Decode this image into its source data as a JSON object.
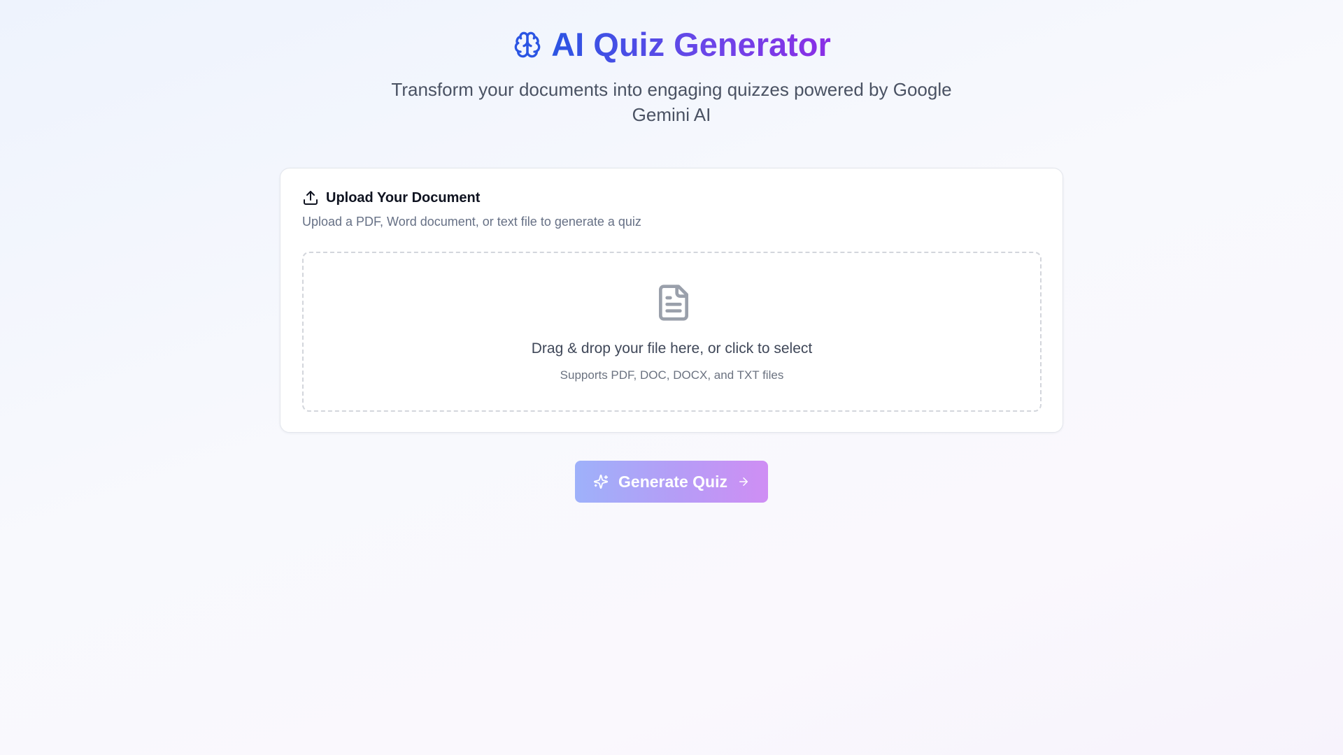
{
  "header": {
    "title": "AI Quiz Generator",
    "title_icon": "brain-icon",
    "subtitle": "Transform your documents into engaging quizzes powered by Google Gemini AI"
  },
  "upload_card": {
    "icon": "upload-icon",
    "title": "Upload Your Document",
    "description": "Upload a PDF, Word document, or text file to generate a quiz",
    "dropzone": {
      "icon": "file-text-icon",
      "main_text": "Drag & drop your file here, or click to select",
      "sub_text": "Supports PDF, DOC, DOCX, and TXT files"
    }
  },
  "generate_button": {
    "label": "Generate Quiz",
    "left_icon": "sparkles-icon",
    "right_icon": "arrow-right-icon"
  },
  "colors": {
    "title_gradient_start": "#2b55e3",
    "title_gradient_end": "#8b2ee6",
    "button_gradient_start": "#9eb1fa",
    "button_gradient_end": "#cf8ef4"
  }
}
